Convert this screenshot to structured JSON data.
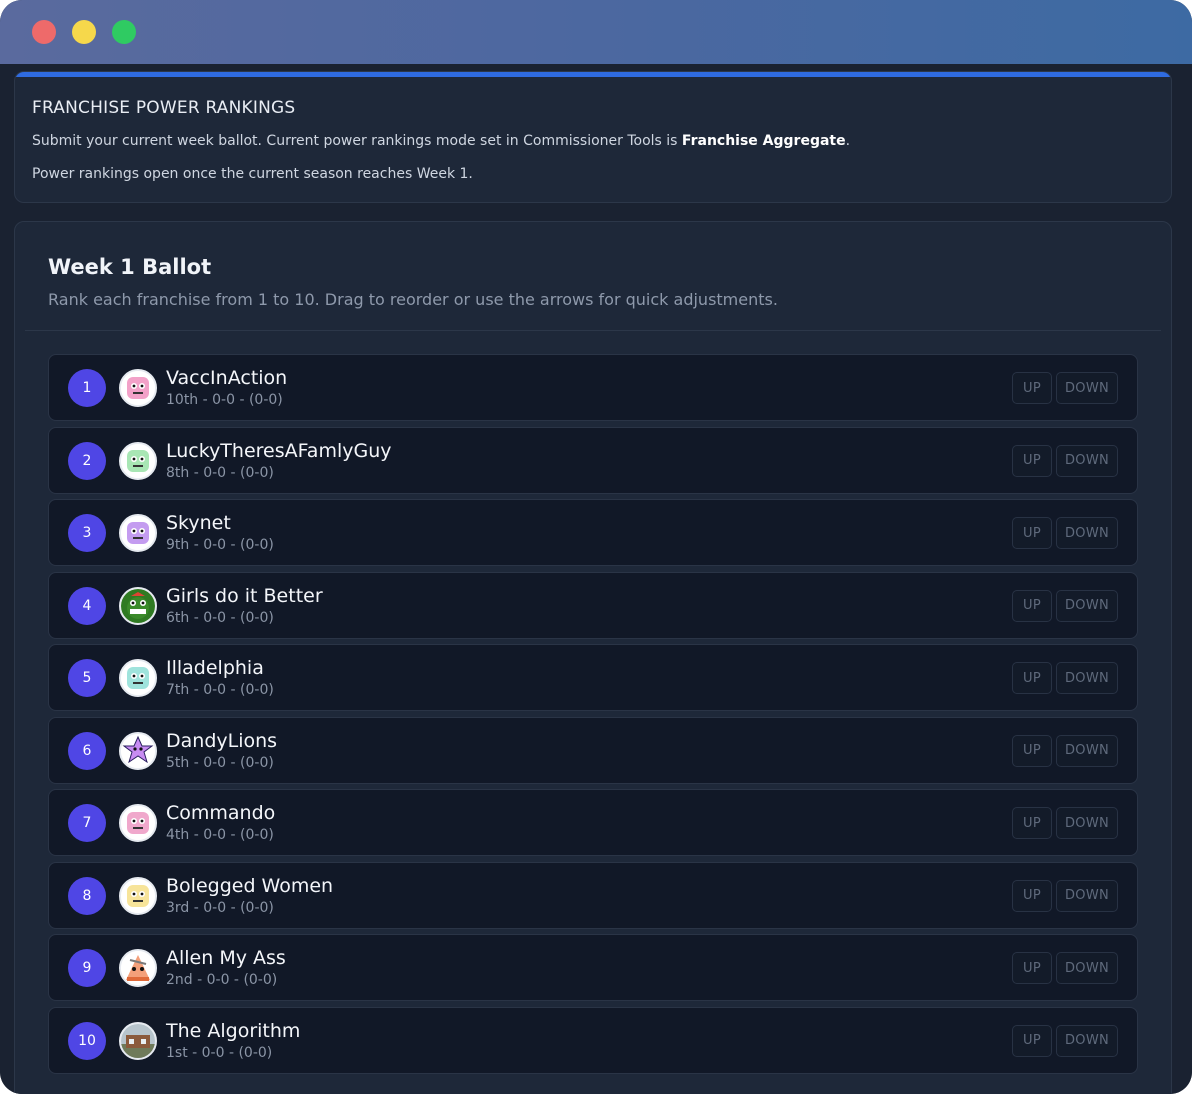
{
  "window": {
    "controls": [
      "close",
      "minimize",
      "maximize"
    ]
  },
  "hero": {
    "title": "FRANCHISE POWER RANKINGS",
    "line1_prefix": "Submit your current week ballot. Current power rankings mode set in Commissioner Tools is ",
    "line1_mode": "Franchise Aggregate",
    "line1_suffix": ".",
    "line2": "Power rankings open once the current season reaches Week 1."
  },
  "ballot": {
    "title": "Week 1 Ballot",
    "subtitle": "Rank each franchise from 1 to 10. Drag to reorder or use the arrows for quick adjustments.",
    "up_label": "UP",
    "down_label": "DOWN",
    "teams": [
      {
        "rank": "1",
        "name": "VaccInAction",
        "record": "10th - 0-0 - (0-0)",
        "avatar": "pink-robot-avatar-icon",
        "color": "#f2a1c8"
      },
      {
        "rank": "2",
        "name": "LuckyTheresAFamlyGuy",
        "record": "8th - 0-0 - (0-0)",
        "avatar": "green-robot-avatar-icon",
        "color": "#a8e6b4"
      },
      {
        "rank": "3",
        "name": "Skynet",
        "record": "9th - 0-0 - (0-0)",
        "avatar": "purple-robot-avatar-icon",
        "color": "#c49cf0"
      },
      {
        "rank": "4",
        "name": "Girls do it Better",
        "record": "6th - 0-0 - (0-0)",
        "avatar": "green-monster-avatar-icon",
        "color": "#3b8a2a"
      },
      {
        "rank": "5",
        "name": "Illadelphia",
        "record": "7th - 0-0 - (0-0)",
        "avatar": "teal-robot-avatar-icon",
        "color": "#9fe3dc"
      },
      {
        "rank": "6",
        "name": "DandyLions",
        "record": "5th - 0-0 - (0-0)",
        "avatar": "purple-star-avatar-icon",
        "color": "#c88cf2"
      },
      {
        "rank": "7",
        "name": "Commando",
        "record": "4th - 0-0 - (0-0)",
        "avatar": "pink-robot-glasses-avatar-icon",
        "color": "#f0a8cc"
      },
      {
        "rank": "8",
        "name": "Bolegged Women",
        "record": "3rd - 0-0 - (0-0)",
        "avatar": "yellow-robot-avatar-icon",
        "color": "#f7e49a"
      },
      {
        "rank": "9",
        "name": "Allen My Ass",
        "record": "2nd - 0-0 - (0-0)",
        "avatar": "cone-robot-avatar-icon",
        "color": "#f4a07a"
      },
      {
        "rank": "10",
        "name": "The Algorithm",
        "record": "1st - 0-0 - (0-0)",
        "avatar": "building-photo-avatar-icon",
        "color": "#8a8f7a"
      }
    ]
  }
}
